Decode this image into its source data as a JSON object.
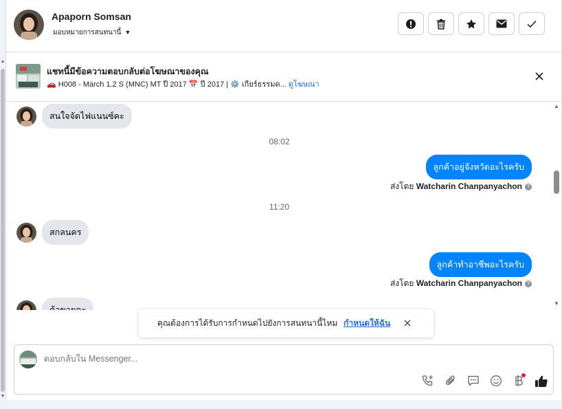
{
  "header": {
    "name": "Apaporn Somsan",
    "assign_label": "มอบหมายการสนทนานี้",
    "actions": [
      "spam-icon",
      "trash-icon",
      "star-icon",
      "envelope-icon",
      "check-icon"
    ]
  },
  "ad": {
    "title": "แชทนี้มีข้อความตอบกลับต่อโฆษณาของคุณ",
    "meta": "🚗 H008 - March 1.2 S (MNC) MT ปี 2017 📅 ปี 2017 | ⚙️ เกียร์ธรรมด...",
    "link": "ดูโฆษณา"
  },
  "messages": {
    "m1": "สนใจจัดไฟแนนซ์คะ",
    "t1": "08:02",
    "m2": "ลูกค้าอยู่จังหวัดอะไรครับ",
    "sent_prefix": "ส่งโดย",
    "agent": "Watcharin Chanpanyachon",
    "t2": "11:20",
    "m3": "สกลนคร",
    "m4": "ลูกค้าทำอาชีพอะไรครับ",
    "m5": "ค้าขายคะ"
  },
  "toast": {
    "text": "คุณต้องการได้รับการกำหนดไปยังการสนทนานี้ไหม",
    "link": "กำหนดให้ฉัน"
  },
  "composer": {
    "placeholder": "ตอบกลับใน Messenger...",
    "tools": [
      "call-add-icon",
      "paperclip-icon",
      "saved-reply-icon",
      "emoji-icon",
      "baht-icon",
      "thumbs-up-icon"
    ]
  },
  "colors": {
    "accent": "#0084ff",
    "link": "#216fdb",
    "bubble_in": "#e4e6eb",
    "notify": "#e41e3f"
  }
}
